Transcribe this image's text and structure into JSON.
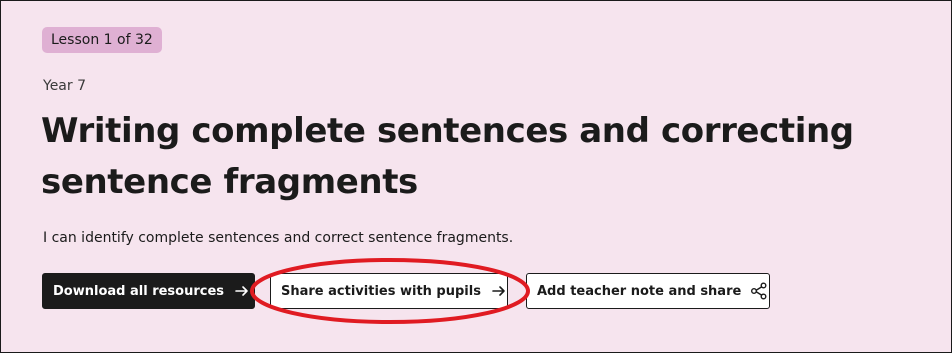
{
  "lesson": {
    "badge": "Lesson 1 of 32",
    "year": "Year 7",
    "title": "Writing complete sentences and correcting sentence fragments",
    "objective": "I can identify complete sentences and correct sentence fragments."
  },
  "actions": {
    "download_label": "Download all resources",
    "share_label": "Share activities with pupils",
    "note_label": "Add teacher note and share"
  },
  "icons": {
    "download": "arrow-right-icon",
    "share": "arrow-right-icon",
    "note": "share-icon"
  },
  "colors": {
    "background": "#f6e4ee",
    "badge": "#dfb0d3",
    "primary": "#1b1b1b",
    "annotation": "#e01b22"
  }
}
